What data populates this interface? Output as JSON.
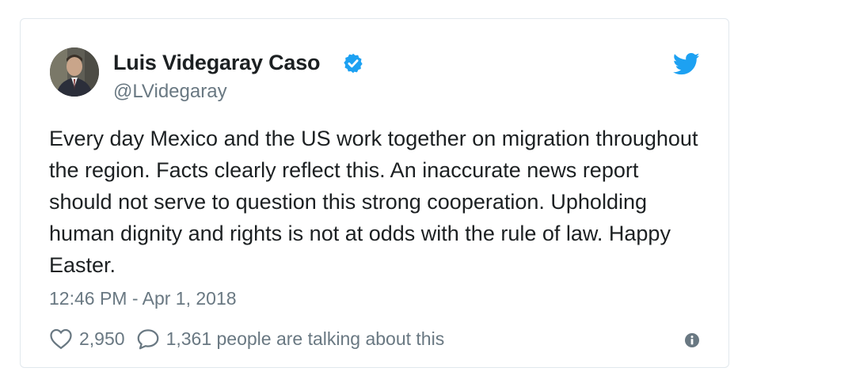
{
  "tweet": {
    "display_name": "Luis Videgaray Caso",
    "handle": "@LVidegaray",
    "text": "Every day Mexico and the US work together on migration throughout the region. Facts clearly reflect this. An inaccurate news report should not serve to question this strong cooperation. Upholding human dignity and rights is not at odds with the rule of law. Happy Easter.",
    "timestamp": "12:46 PM - Apr 1, 2018",
    "likes": "2,950",
    "talking": "1,361 people are talking about this"
  },
  "icons": {
    "verified": "verified-badge-icon",
    "brand": "twitter-bird-icon",
    "like": "heart-icon",
    "reply": "speech-bubble-icon",
    "info": "info-icon"
  },
  "colors": {
    "accent": "#1da1f2",
    "text": "#1c2022",
    "muted": "#697882",
    "border": "#e1e8ed"
  }
}
